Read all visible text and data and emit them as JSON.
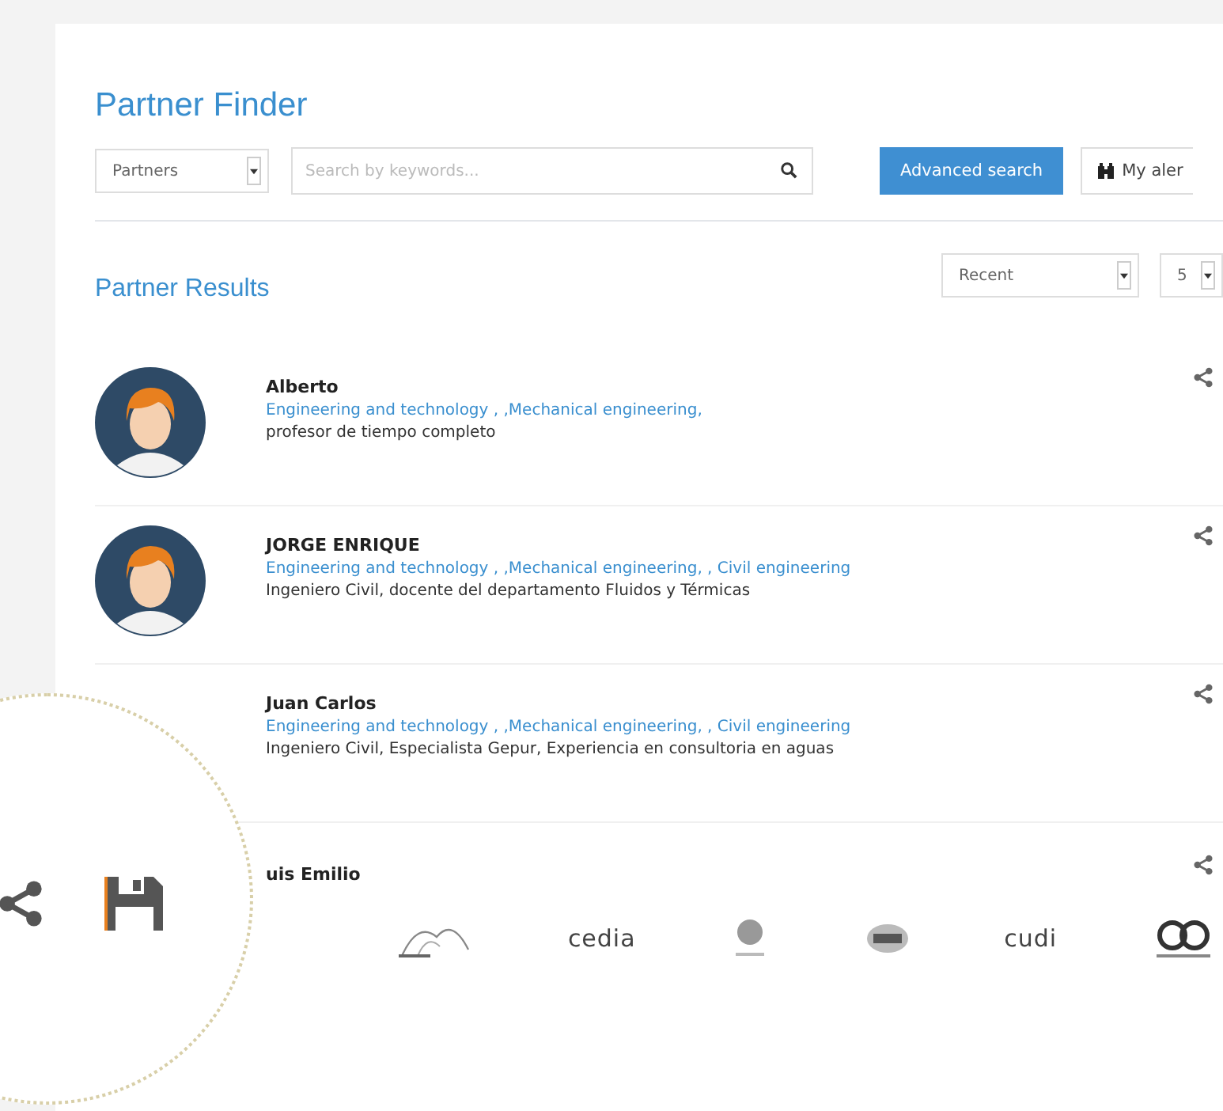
{
  "title": "Partner Finder",
  "toolbar": {
    "type_select": "Partners",
    "search": {
      "placeholder": "Search by keywords..."
    },
    "advanced_button": "Advanced search",
    "alerts_button": "My aler"
  },
  "results": {
    "title": "Partner Results",
    "sort_select": "Recent",
    "page_size_select": "5"
  },
  "partners": [
    {
      "avatar": true,
      "name": "Alberto",
      "areas": "Engineering and technology , ,Mechanical engineering,",
      "description": "profesor de tiempo completo"
    },
    {
      "avatar": true,
      "name": "JORGE ENRIQUE",
      "areas": "Engineering and technology , ,Mechanical engineering, , Civil engineering",
      "description": "Ingeniero Civil, docente del departamento Fluidos y Térmicas"
    },
    {
      "avatar": false,
      "name": "Juan Carlos",
      "areas": "Engineering and technology , ,Mechanical engineering, , Civil engineering",
      "description": "Ingeniero Civil, Especialista Gepur, Experiencia en consultoria en aguas"
    },
    {
      "name": "uis Emilio"
    }
  ],
  "logos": [
    {
      "kind": "arches"
    },
    {
      "kind": "text",
      "label": "cedia"
    },
    {
      "kind": "globe"
    },
    {
      "kind": "seal"
    },
    {
      "kind": "text",
      "label": "cudi"
    },
    {
      "kind": "swirl"
    }
  ]
}
